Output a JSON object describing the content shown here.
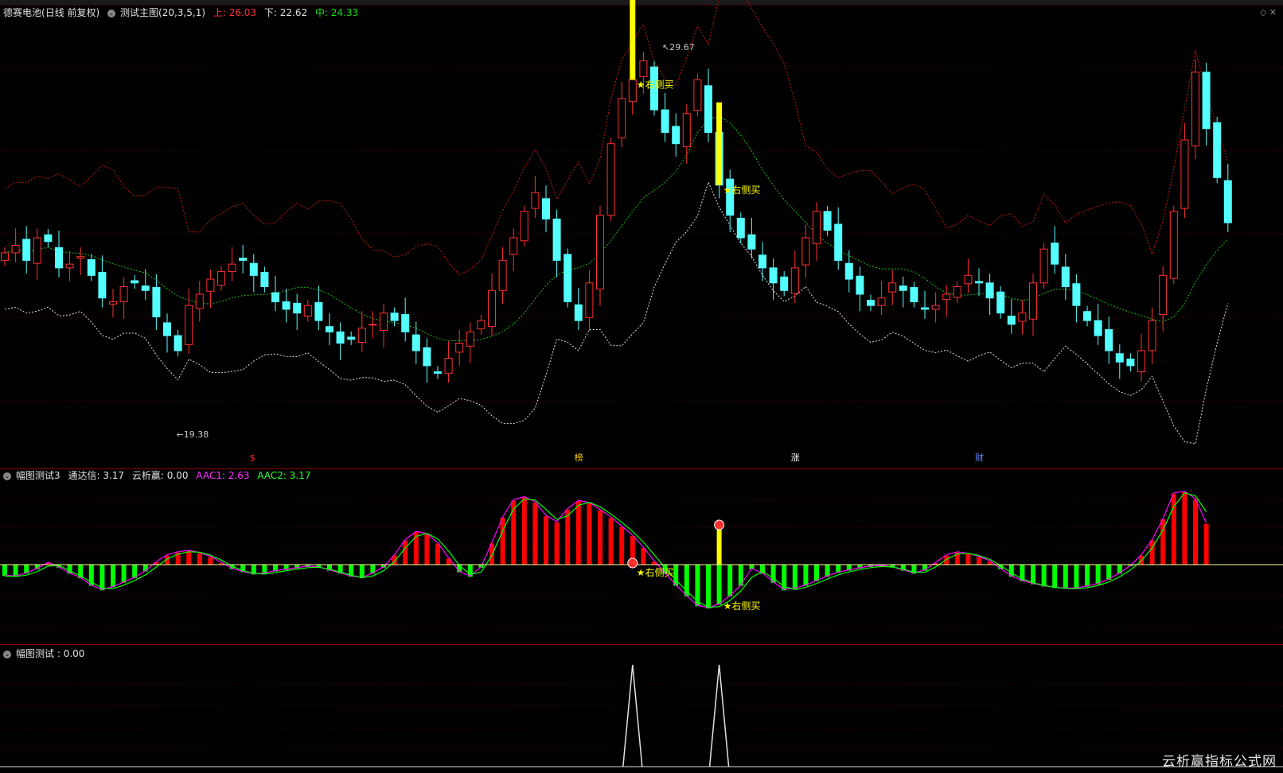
{
  "main_panel": {
    "stock_name": "德赛电池",
    "period": "(日线 前复权)",
    "indicator": "测试主图(20,3,5,1)",
    "upper_label": "上:",
    "upper_value": "26.03",
    "lower_label": "下:",
    "lower_value": "22.62",
    "mid_label": "中:",
    "mid_value": "24.33",
    "high_annotation": "29.67",
    "low_annotation": "19.38",
    "signal_text": "★右侧买",
    "markers": [
      "$",
      "榜",
      "涨",
      "财"
    ]
  },
  "panel2": {
    "title": "幅图测试3",
    "tongda_label": "通达信:",
    "tongda_value": "3.17",
    "yunxi_label": "云析赢:",
    "yunxi_value": "0.00",
    "aac1_label": "AAC1:",
    "aac1_value": "2.63",
    "aac2_label": "AAC2:",
    "aac2_value": "3.17",
    "signal_text": "★右侧买"
  },
  "panel3": {
    "title": "幅图测试",
    "value_label": ":",
    "value": "0.00"
  },
  "watermark": "云析赢指标公式网",
  "colors": {
    "up": "#ff3030",
    "down": "#54ffff",
    "upper_band": "#c01818",
    "mid_band": "#18c018",
    "lower_band": "#e0e0e0",
    "signal": "#ffff00",
    "hist_up": "#ff0000",
    "hist_down": "#00ff00",
    "aac1": "#ff00ff",
    "aac2": "#00ff00"
  },
  "chart_data": {
    "type": "candlestick",
    "high_marker": 29.67,
    "low_marker": 19.38,
    "bands": {
      "upper": 26.03,
      "lower": 22.62,
      "mid": 24.33
    },
    "close_series": [
      24.2,
      24.4,
      24.0,
      24.6,
      24.5,
      23.8,
      23.9,
      24.1,
      23.6,
      23.0,
      22.9,
      23.3,
      23.4,
      23.2,
      22.5,
      22.0,
      21.6,
      22.8,
      23.1,
      23.5,
      23.7,
      23.9,
      24.0,
      23.6,
      23.3,
      22.9,
      22.7,
      22.6,
      22.8,
      22.4,
      22.1,
      21.8,
      21.9,
      22.2,
      22.3,
      22.6,
      22.4,
      22.1,
      21.6,
      21.2,
      21.0,
      21.4,
      21.8,
      22.1,
      22.4,
      23.2,
      24.0,
      24.6,
      25.3,
      25.8,
      25.1,
      24.0,
      22.9,
      22.4,
      23.4,
      25.2,
      27.1,
      28.3,
      28.8,
      29.3,
      28.0,
      27.4,
      27.1,
      27.9,
      28.8,
      27.4,
      26.0,
      25.2,
      24.6,
      24.3,
      23.8,
      23.4,
      23.2,
      23.8,
      24.6,
      25.3,
      24.8,
      24.0,
      23.5,
      23.1,
      22.8,
      23.0,
      23.4,
      23.2,
      22.9,
      22.7,
      22.8,
      23.1,
      23.3,
      23.6,
      23.4,
      23.0,
      22.6,
      22.3,
      22.6,
      23.4,
      24.3,
      23.9,
      23.3,
      22.8,
      22.4,
      22.0,
      21.6,
      21.3,
      21.2,
      21.6,
      22.4,
      23.6,
      25.3,
      27.2,
      29.0,
      27.5,
      26.2,
      25.0
    ],
    "oscillator": [
      -1.5,
      -1.6,
      -1.2,
      -0.6,
      0.2,
      -0.4,
      -1.2,
      -1.8,
      -2.8,
      -3.4,
      -3.0,
      -2.4,
      -1.8,
      -0.9,
      0.3,
      1.2,
      1.6,
      1.8,
      1.5,
      1.0,
      0.2,
      -0.6,
      -1.0,
      -1.3,
      -1.2,
      -0.9,
      -0.7,
      -0.5,
      -0.3,
      -0.4,
      -0.8,
      -1.2,
      -1.6,
      -1.8,
      -1.2,
      -0.4,
      1.2,
      3.2,
      4.3,
      4.0,
      2.8,
      0.8,
      -1.0,
      -1.6,
      -0.4,
      2.8,
      6.2,
      8.5,
      8.9,
      8.2,
      6.4,
      5.6,
      7.3,
      8.4,
      8.1,
      7.2,
      6.2,
      5.0,
      3.8,
      2.2,
      0.4,
      -1.2,
      -2.8,
      -4.2,
      -5.5,
      -5.8,
      -5.3,
      -4.2,
      -2.8,
      -0.6,
      -1.2,
      -2.4,
      -3.4,
      -3.2,
      -2.8,
      -2.2,
      -1.6,
      -1.1,
      -0.8,
      -0.5,
      -0.3,
      -0.2,
      -0.4,
      -0.8,
      -1.2,
      -0.8,
      0.2,
      1.2,
      1.6,
      1.4,
      1.0,
      0.4,
      -0.6,
      -1.6,
      -2.2,
      -2.6,
      -2.9,
      -3.1,
      -3.2,
      -3.2,
      -2.9,
      -2.6,
      -2.0,
      -1.2,
      -0.2,
      1.2,
      3.2,
      6.0,
      9.4,
      9.6,
      8.6,
      5.4
    ],
    "signal_spikes": [
      58,
      66
    ]
  }
}
